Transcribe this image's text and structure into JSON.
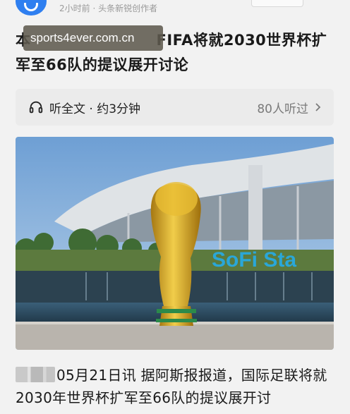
{
  "header": {
    "meta": "2小时前 · 头条新锐创作者"
  },
  "article": {
    "title_prefix": "本",
    "title_rest": "FIFA将就2030世界杯扩军至66队的提议展开讨论",
    "watermark": "sports4ever.com.cn",
    "listen_label": "听全文 · 约3分钟",
    "listen_count": "80人听过",
    "photo_sign": "SoFi Sta",
    "body": "05月21日讯 据阿斯报报道，国际足联将就2030年世界杯扩军至66队的提议展开讨"
  },
  "colors": {
    "accent": "#2f7ff0",
    "sofi": "#2aa7d8",
    "trophy": "#d9a625",
    "trophy_band": "#2b8a4a"
  },
  "icons": {
    "listen": "headphones-icon",
    "more": "chevron-right-icon"
  }
}
